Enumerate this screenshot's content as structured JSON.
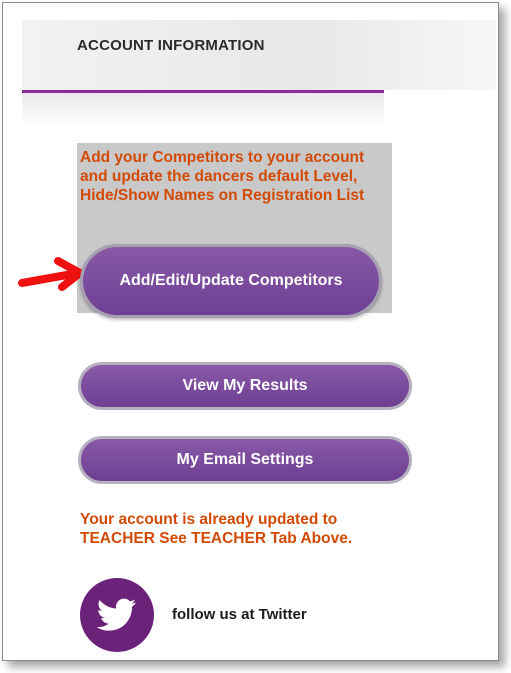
{
  "account": {
    "title": "ACCOUNT INFORMATION"
  },
  "competitors": {
    "description": "Add your Competitors to your account and update the dancers default Level, Hide/Show Names on Registration List",
    "button_label": "Add/Edit/Update Competitors"
  },
  "buttons": {
    "view_results": "View My Results",
    "email_settings": "My Email Settings"
  },
  "upgrade_notice": "Your account is already updated to TEACHER See TEACHER Tab Above.",
  "social": {
    "twitter_label": "follow us at Twitter",
    "icon": "twitter-bird-icon"
  },
  "colors": {
    "accent_purple": "#7a4a9c",
    "notice_orange": "#d24a05",
    "twitter_circle": "#6b237a",
    "annotation_red": "#ef1010"
  }
}
